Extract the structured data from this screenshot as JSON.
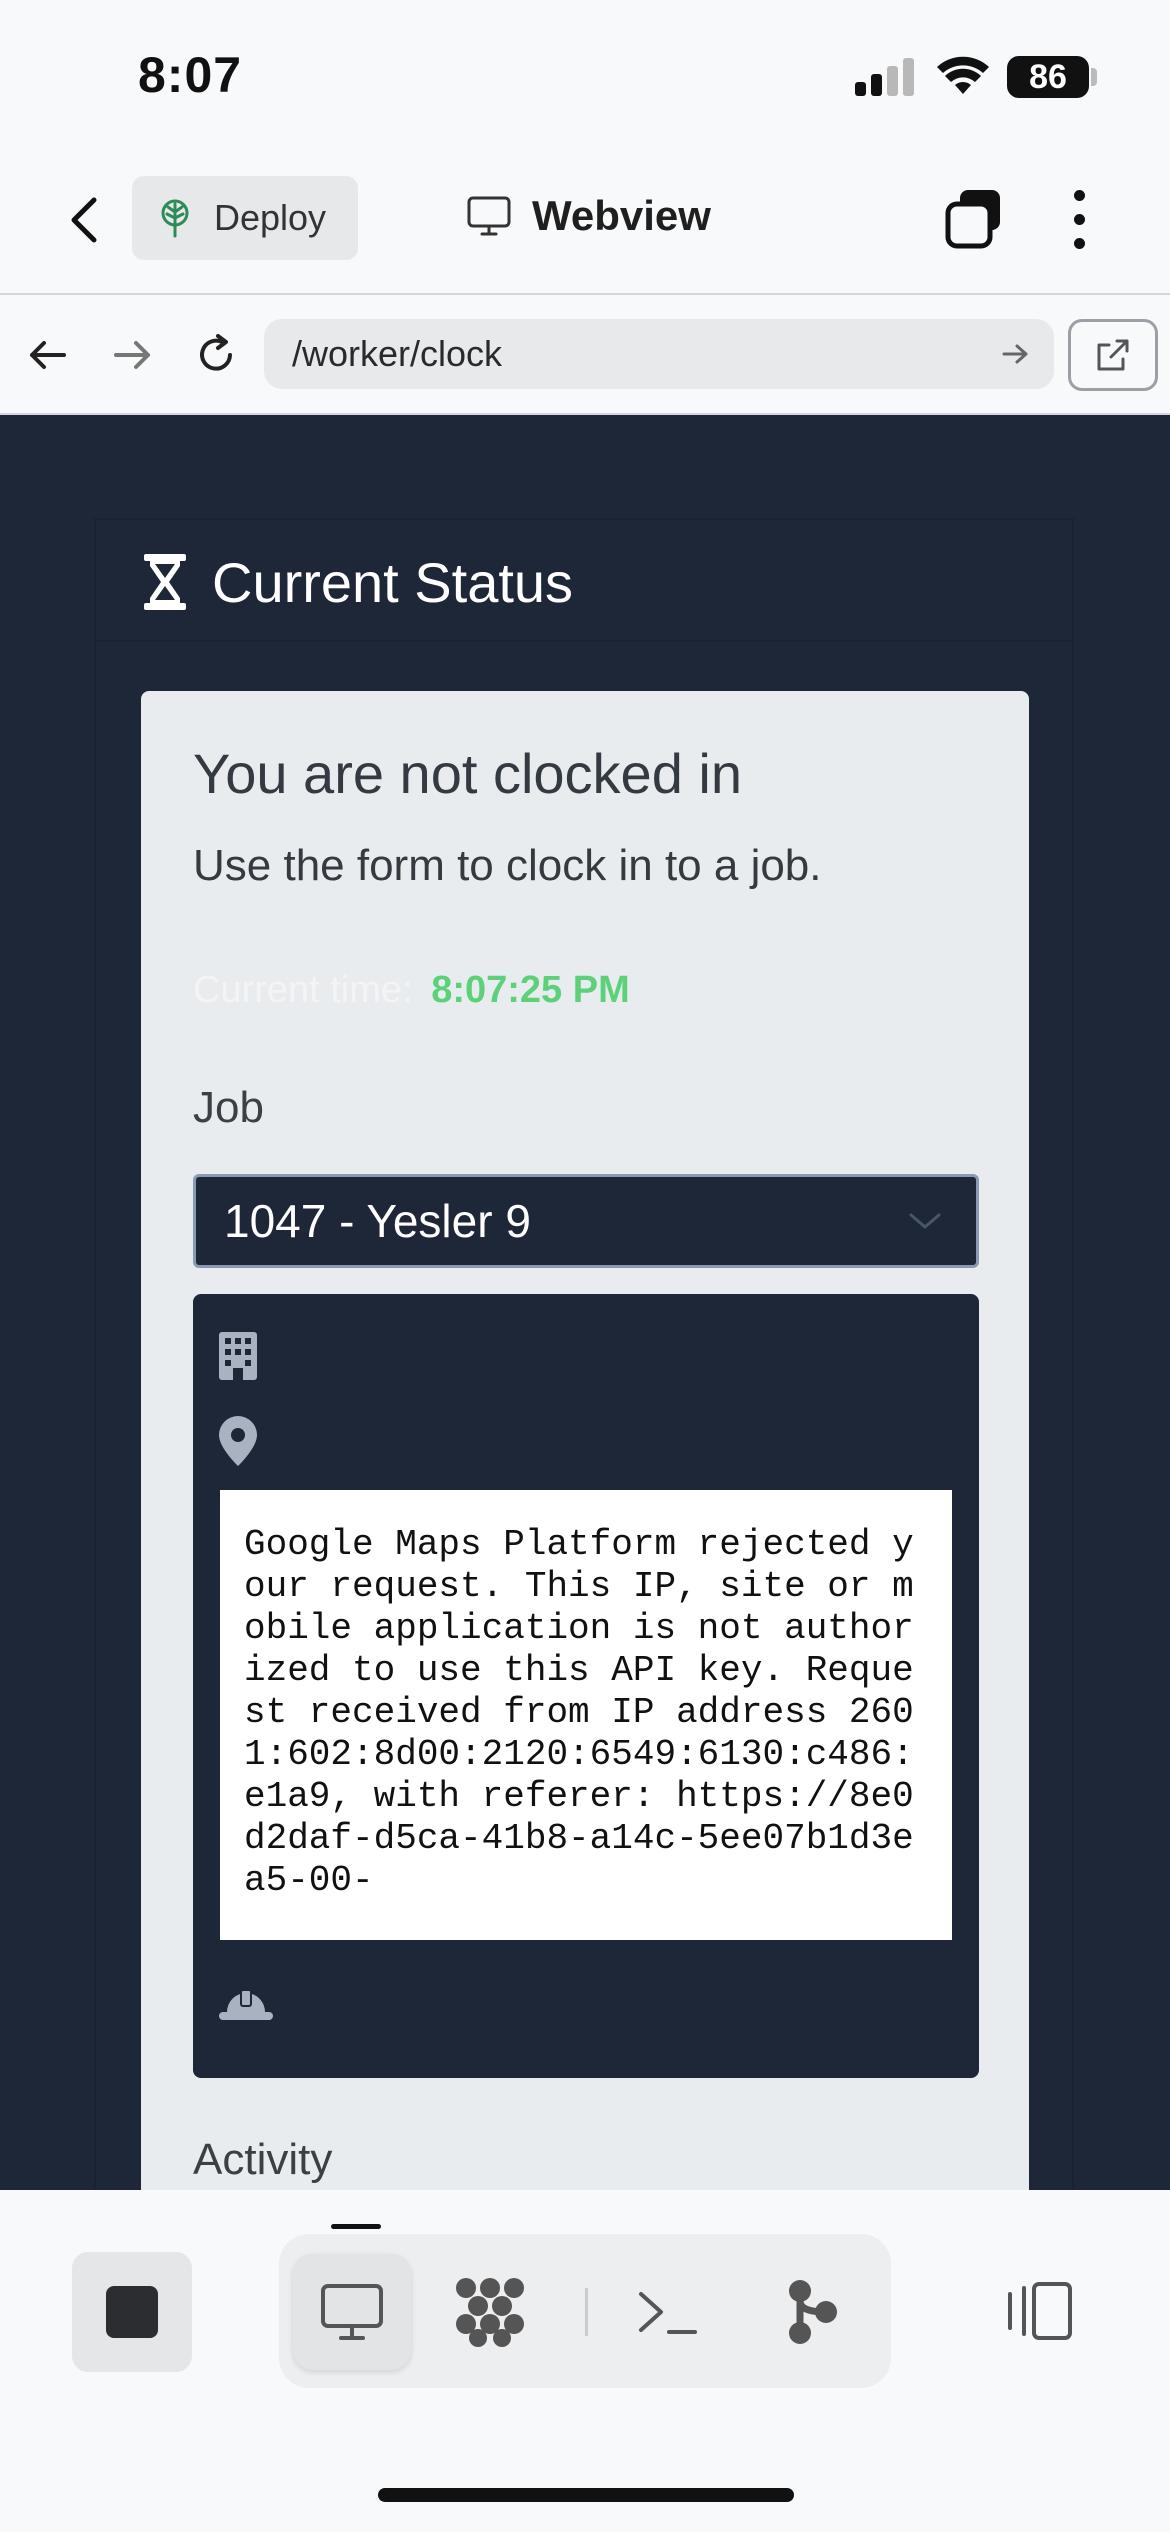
{
  "status_bar": {
    "time": "8:07",
    "battery": "86"
  },
  "app_header": {
    "deploy_label": "Deploy",
    "title": "Webview"
  },
  "browser": {
    "url": "/worker/clock"
  },
  "page": {
    "panel_title": "Current Status",
    "status_title": "You are not clocked in",
    "status_subtitle": "Use the form to clock in to a job.",
    "current_time_label": "Current time:",
    "current_time_value": "8:07:25 PM",
    "job_label": "Job",
    "job_selected": "1047 - Yesler 9",
    "map_error": "Google Maps Platform rejected your request. This IP, site or mobile application is not authorized to use this API key. Request received from IP address 2601:602:8d00:2120:6549:6130:c486:e1a9, with referer: https://8e0d2daf-d5ca-41b8-a14c-5ee07b1d3ea5-00-",
    "activity_label": "Activity"
  },
  "colors": {
    "page_bg": "#1e2737",
    "card_bg": "#e9ecef",
    "time_accent": "#5cd17a",
    "deploy_icon": "#2e8b57"
  },
  "icons": {
    "header": [
      "chevron-left-icon",
      "deploy-tree-icon",
      "monitor-icon",
      "tabs-icon",
      "more-vertical-icon"
    ],
    "browser": [
      "arrow-left-icon",
      "arrow-right-icon",
      "reload-icon",
      "arrow-right-small-icon",
      "open-external-icon"
    ],
    "page": [
      "hourglass-icon",
      "chevron-down-icon",
      "building-icon",
      "map-pin-icon",
      "hard-hat-icon"
    ],
    "toolbar": [
      "stop-icon",
      "monitor-icon",
      "grid-dots-icon",
      "terminal-icon",
      "git-branch-icon",
      "side-panel-icon"
    ]
  }
}
